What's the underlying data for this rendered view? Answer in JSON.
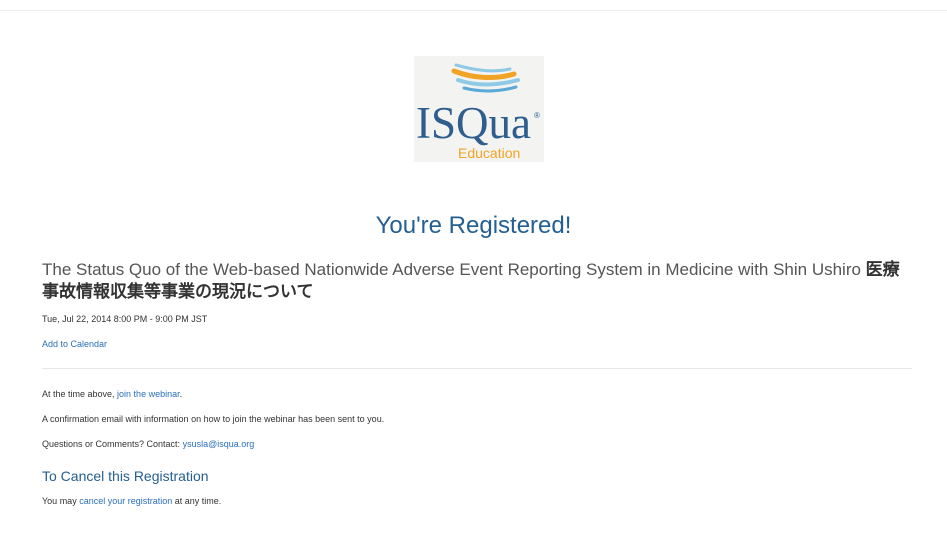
{
  "logo": {
    "wordmark": "ISQua",
    "registered_mark": "®",
    "subtitle": "Education",
    "colors": {
      "navy": "#2e5d8e",
      "orange": "#f0a324",
      "light_blue": "#8ec9e6"
    }
  },
  "page": {
    "headline": "You're Registered!"
  },
  "event": {
    "title_en": "The Status Quo of the Web-based Nationwide Adverse Event Reporting System in Medicine with Shin Ushiro ",
    "title_jp": "医療事故情報収集等事業の現況について",
    "datetime": "Tue, Jul 22, 2014 8:00 PM - 9:00 PM JST",
    "add_to_calendar": "Add to Calendar"
  },
  "info": {
    "time_prefix": "At the time above, ",
    "join_link": "join the webinar",
    "time_suffix": ".",
    "confirmation": "A confirmation email with information on how to join the webinar has been sent to you.",
    "contact_prefix": "Questions or Comments? Contact: ",
    "contact_email": "ysusla@isqua.org"
  },
  "cancel": {
    "heading": "To Cancel this Registration",
    "prefix": "You may ",
    "link": "cancel your registration",
    "suffix": " at any time."
  }
}
